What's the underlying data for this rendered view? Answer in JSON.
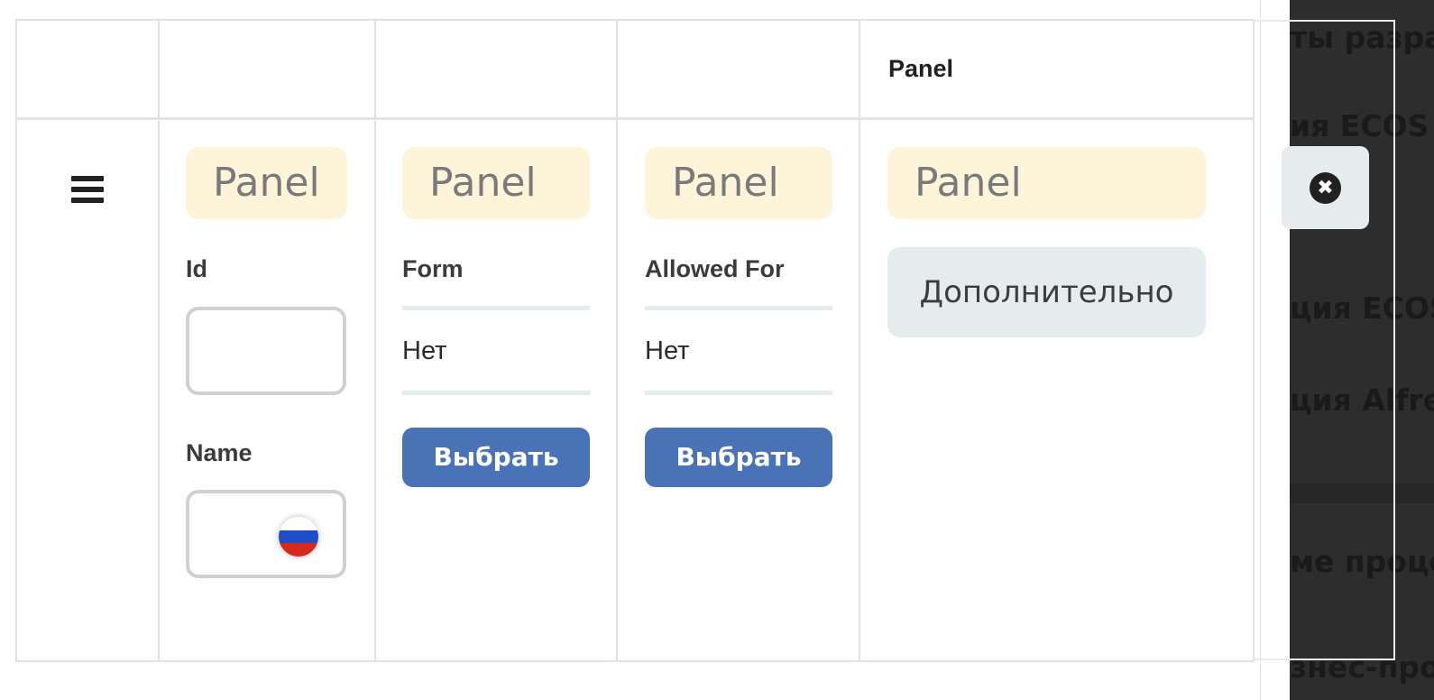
{
  "background_list": {
    "items": [
      "ты разра",
      "ия ECOS",
      "S",
      "ция ECOS",
      "ция Alfres",
      "ме процес",
      "знес-проц"
    ]
  },
  "header": {
    "col5_label": "Panel"
  },
  "row": {
    "drag_icon": "hamburger-icon",
    "col1": {
      "panel_label": "Panel",
      "id_label": "Id",
      "id_value": "",
      "name_label": "Name",
      "name_value": "",
      "language_flag": "russia-flag-icon"
    },
    "col2": {
      "panel_label": "Panel",
      "field_label": "Form",
      "value": "Нет",
      "button_label": "Выбрать"
    },
    "col3": {
      "panel_label": "Panel",
      "field_label": "Allowed For",
      "value": "Нет",
      "button_label": "Выбрать"
    },
    "col4": {
      "panel_label": "Panel",
      "button_label": "Дополнительно"
    },
    "remove_icon": "close-circle-icon",
    "remove_symbol": "✖"
  },
  "colors": {
    "panel_chip_bg": "#fdf4d9",
    "primary_button": "#4a72b6",
    "secondary_button": "#e6ebee",
    "border": "#dfe3e7"
  }
}
